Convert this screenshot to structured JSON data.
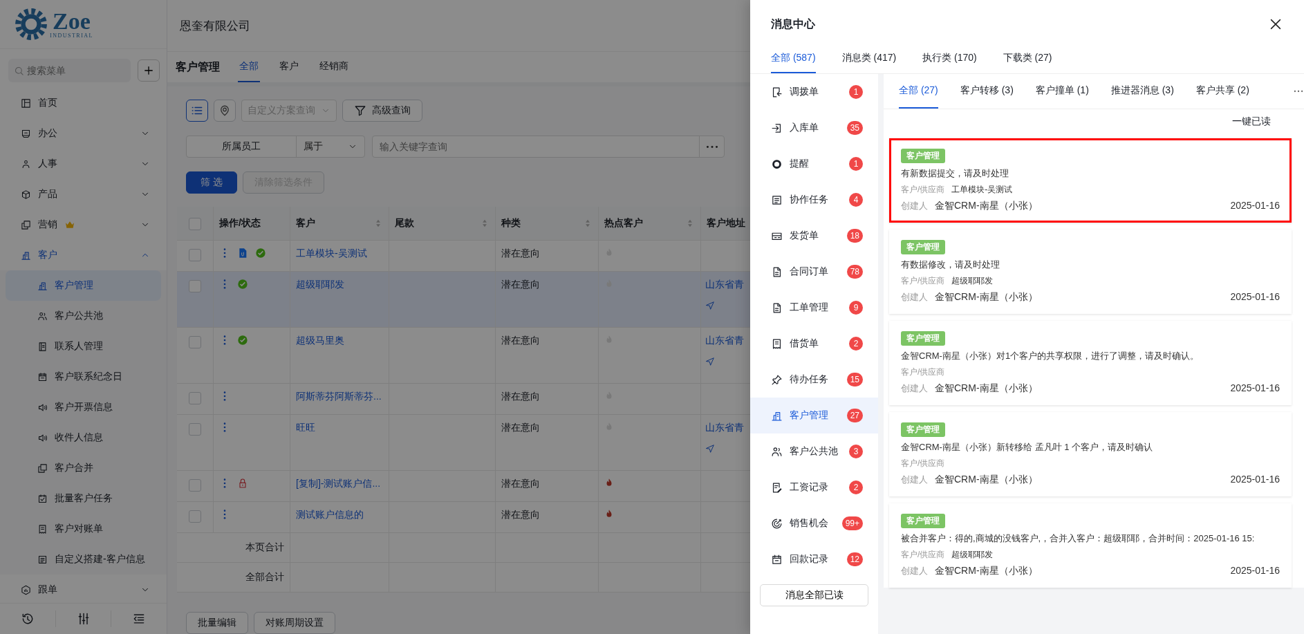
{
  "logo": {
    "mark": "Zoe",
    "tagline": "INDUSTRIAL"
  },
  "sidebar": {
    "search": {
      "placeholder": "搜索菜单"
    },
    "items": [
      {
        "label": "首页",
        "selected": false,
        "premium": false
      },
      {
        "label": "办公",
        "selected": false,
        "premium": false,
        "expanded": false
      },
      {
        "label": "人事",
        "selected": false,
        "premium": false,
        "expanded": false
      },
      {
        "label": "产品",
        "selected": false,
        "premium": false,
        "expanded": false
      },
      {
        "label": "营销",
        "selected": false,
        "premium": true,
        "expanded": false
      },
      {
        "label": "客户",
        "selected": true,
        "premium": false,
        "expanded": true,
        "children": [
          {
            "label": "客户管理",
            "selected": true
          },
          {
            "label": "客户公共池",
            "selected": false
          },
          {
            "label": "联系人管理",
            "selected": false
          },
          {
            "label": "客户联系纪念日",
            "selected": false
          },
          {
            "label": "客户开票信息",
            "selected": false
          },
          {
            "label": "收件人信息",
            "selected": false
          },
          {
            "label": "客户合并",
            "selected": false
          },
          {
            "label": "批量客户任务",
            "selected": false
          },
          {
            "label": "客户对账单",
            "selected": false
          },
          {
            "label": "自定义搭建-客户信息",
            "selected": false
          }
        ]
      },
      {
        "label": "跟单",
        "selected": false,
        "premium": false,
        "expanded": false
      }
    ]
  },
  "header": {
    "company": "恩奎有限公司"
  },
  "page": {
    "title": "客户管理",
    "tabs": [
      {
        "label": "全部",
        "selected": true
      },
      {
        "label": "客户",
        "selected": false
      },
      {
        "label": "经销商",
        "selected": false
      }
    ]
  },
  "toolbar": {
    "view_modes": [
      {
        "kind": "list",
        "selected": true
      },
      {
        "kind": "map",
        "selected": false
      }
    ],
    "scheme": {
      "placeholder": "自定义方案查询"
    },
    "advanced_button": "高级查询"
  },
  "filter": {
    "field": "所属员工",
    "operator": "属于",
    "keyword": {
      "placeholder": "输入关键字查询"
    }
  },
  "actions": [
    {
      "label": "筛 选",
      "kind": "primary",
      "disabled": false
    },
    {
      "label": "清除筛选条件",
      "kind": "default",
      "disabled": true
    }
  ],
  "table": {
    "select_all_checked": false,
    "columns": [
      {
        "label": "操作/状态",
        "sortable": false
      },
      {
        "label": "客户",
        "sortable": true
      },
      {
        "label": "尾款",
        "sortable": true
      },
      {
        "label": "种类",
        "sortable": true
      },
      {
        "label": "热点客户",
        "sortable": true
      },
      {
        "label": "客户地址",
        "sortable": false
      }
    ],
    "rows": [
      {
        "checked": false,
        "selected": false,
        "document": true,
        "approved": true,
        "locked": false,
        "customer": "工单模块-吴测试",
        "category": "潜在意向",
        "hot": false
      },
      {
        "checked": false,
        "selected": true,
        "document": false,
        "approved": true,
        "locked": false,
        "customer": "超级耶耶发",
        "category": "潜在意向",
        "hot": false,
        "address": "山东省青"
      },
      {
        "checked": false,
        "selected": false,
        "document": false,
        "approved": true,
        "locked": false,
        "customer": "超级马里奥",
        "category": "潜在意向",
        "hot": false,
        "address": "山东省青"
      },
      {
        "checked": false,
        "selected": false,
        "document": false,
        "approved": false,
        "locked": false,
        "customer": "阿斯蒂芬阿斯蒂芬...",
        "category": "潜在意向",
        "hot": false
      },
      {
        "checked": false,
        "selected": false,
        "document": false,
        "approved": false,
        "locked": false,
        "customer": "旺旺",
        "category": "潜在意向",
        "hot": false,
        "address": "山东省青"
      },
      {
        "checked": false,
        "selected": false,
        "document": false,
        "approved": false,
        "locked": true,
        "customer": "[复制]-测试账户信...",
        "category": "潜在意向",
        "hot": true
      },
      {
        "checked": false,
        "selected": false,
        "document": false,
        "approved": false,
        "locked": false,
        "customer": "测试账户信息的",
        "category": "潜在意向",
        "hot": true
      }
    ],
    "totals": [
      "本页合计",
      "全部合计"
    ]
  },
  "bottom_buttons": [
    "批量编辑",
    "对账周期设置"
  ],
  "message_center": {
    "title": "消息中心",
    "tabs": [
      {
        "label": "全部 (587)",
        "selected": true
      },
      {
        "label": "消息类 (417)",
        "selected": false
      },
      {
        "label": "执行类 (170)",
        "selected": false
      },
      {
        "label": "下载类 (27)",
        "selected": false
      }
    ],
    "categories": [
      {
        "label": "调拨单",
        "count": "1",
        "selected": false
      },
      {
        "label": "入库单",
        "count": "35",
        "selected": false
      },
      {
        "label": "提醒",
        "count": "1",
        "selected": false
      },
      {
        "label": "协作任务",
        "count": "4",
        "selected": false
      },
      {
        "label": "发货单",
        "count": "18",
        "selected": false
      },
      {
        "label": "合同订单",
        "count": "78",
        "selected": false
      },
      {
        "label": "工单管理",
        "count": "9",
        "selected": false
      },
      {
        "label": "借货单",
        "count": "2",
        "selected": false
      },
      {
        "label": "待办任务",
        "count": "15",
        "selected": false
      },
      {
        "label": "客户管理",
        "count": "27",
        "selected": true
      },
      {
        "label": "客户公共池",
        "count": "3",
        "selected": false
      },
      {
        "label": "工资记录",
        "count": "2",
        "selected": false
      },
      {
        "label": "销售机会",
        "count": "99+",
        "selected": false
      },
      {
        "label": "回款记录",
        "count": "12",
        "selected": false
      }
    ],
    "mark_all_button": "消息全部已读",
    "subtabs": [
      {
        "label": "全部 (27)",
        "selected": true
      },
      {
        "label": "客户转移 (3)",
        "selected": false
      },
      {
        "label": "客户撞单 (1)",
        "selected": false
      },
      {
        "label": "推进器消息 (3)",
        "selected": false
      },
      {
        "label": "客户共享 (2)",
        "selected": false
      }
    ],
    "read_all": "一键已读",
    "messages": [
      {
        "tag": "客户管理",
        "text": "有新数据提交，请及时处理",
        "supplier_label": "客户/供应商",
        "supplier": "工单模块-吴测试",
        "creator_label": "创建人",
        "creator": "金智CRM-南星（小张）",
        "date": "2025-01-16",
        "highlighted": true
      },
      {
        "tag": "客户管理",
        "text": "有数据修改，请及时处理",
        "supplier_label": "客户/供应商",
        "supplier": "超级耶耶发",
        "creator_label": "创建人",
        "creator": "金智CRM-南星（小张）",
        "date": "2025-01-16",
        "highlighted": false
      },
      {
        "tag": "客户管理",
        "text": "金智CRM-南星（小张）对1个客户的共享权限，进行了调整，请及时确认。",
        "supplier_label": "客户/供应商",
        "creator_label": "创建人",
        "creator": "金智CRM-南星（小张）",
        "date": "2025-01-16",
        "highlighted": false
      },
      {
        "tag": "客户管理",
        "text": "金智CRM-南星（小张）新转移给 孟凡叶 1 个客户，请及时确认",
        "supplier_label": "客户/供应商",
        "creator_label": "创建人",
        "creator": "金智CRM-南星（小张）",
        "date": "2025-01-16",
        "highlighted": false
      },
      {
        "tag": "客户管理",
        "text": "被合并客户：得的,商城的没钱客户,，合并入客户：超级耶耶，合并时间：2025-01-16 15:",
        "supplier_label": "客户/供应商",
        "supplier": "超级耶耶发",
        "creator_label": "创建人",
        "creator": "金智CRM-南星（小张）",
        "date": "2025-01-16",
        "highlighted": false
      }
    ]
  }
}
